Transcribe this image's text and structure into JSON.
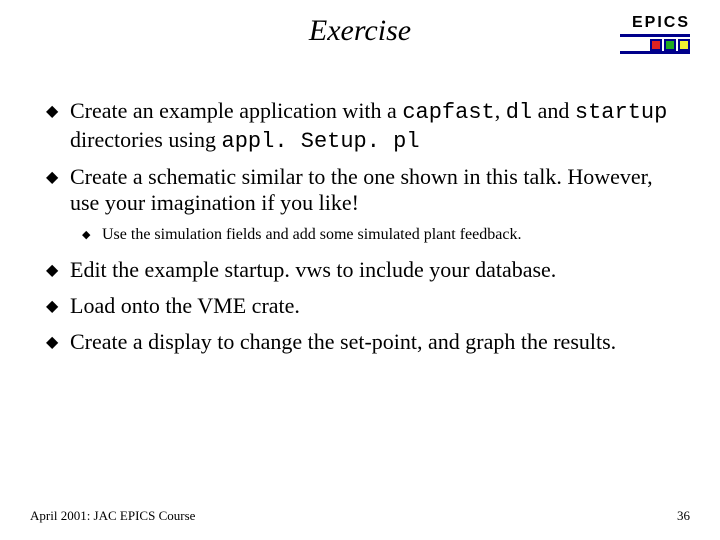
{
  "header": {
    "title": "Exercise",
    "logo_text": "EPICS"
  },
  "bullets": [
    {
      "segments": [
        {
          "t": "Create an example application with a "
        },
        {
          "t": "capfast",
          "mono": true
        },
        {
          "t": ", "
        },
        {
          "t": "dl",
          "mono": true
        },
        {
          "t": " and "
        },
        {
          "t": "startup",
          "mono": true
        },
        {
          "t": " directories using "
        },
        {
          "t": "appl. Setup. pl",
          "mono": true
        }
      ]
    },
    {
      "segments": [
        {
          "t": "Create a schematic similar to the one shown in this talk. However, use your imagination if you like!"
        }
      ],
      "sub": [
        {
          "segments": [
            {
              "t": "Use the simulation fields and add some simulated plant feedback."
            }
          ]
        }
      ]
    },
    {
      "segments": [
        {
          "t": "Edit the example startup. vws to include your database."
        }
      ]
    },
    {
      "segments": [
        {
          "t": "Load onto the VME crate."
        }
      ]
    },
    {
      "segments": [
        {
          "t": "Create a display to change the set-point, and graph the results."
        }
      ]
    }
  ],
  "footer": {
    "left": "April 2001: JAC EPICS Course",
    "right": "36"
  }
}
